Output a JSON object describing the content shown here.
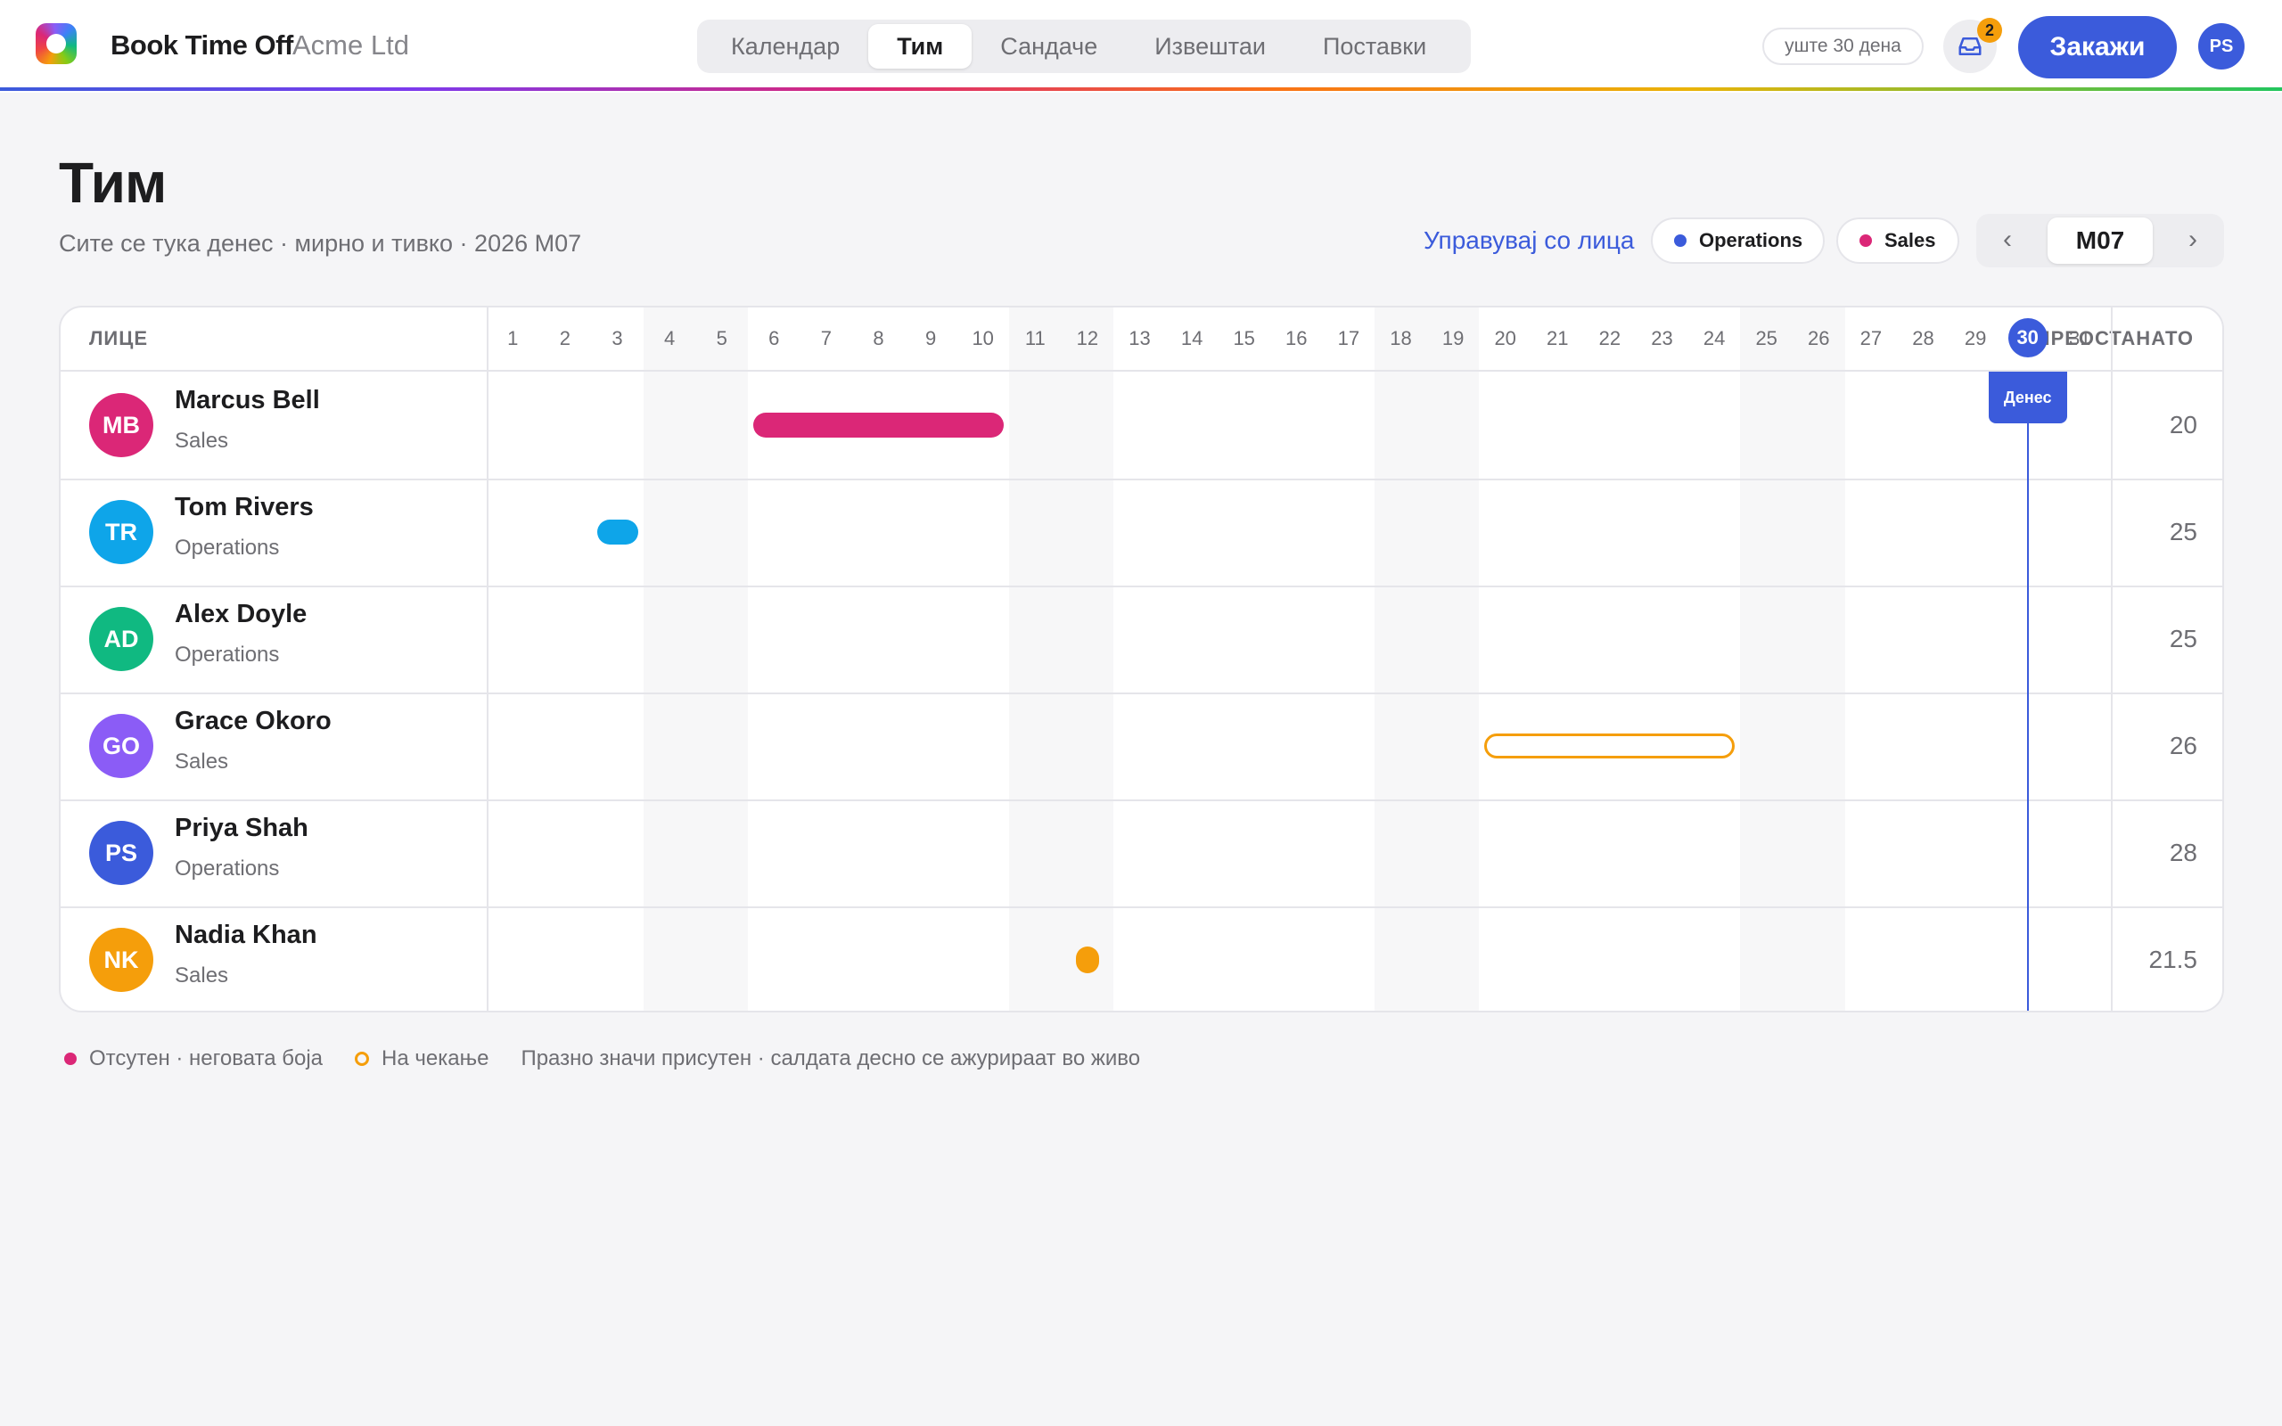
{
  "app": {
    "brand": "Book Time Off",
    "company": "Acme Ltd",
    "trial": "уште 30 дена",
    "inbox_count": "2",
    "book_label": "Закажи",
    "user_initials": "PS"
  },
  "nav": {
    "tabs": [
      {
        "label": "Календар",
        "active": false
      },
      {
        "label": "Тим",
        "active": true
      },
      {
        "label": "Сандаче",
        "active": false
      },
      {
        "label": "Извештаи",
        "active": false
      },
      {
        "label": "Поставки",
        "active": false
      }
    ]
  },
  "header": {
    "title": "Тим",
    "subtitle": "Сите се тука денес · мирно и тивко · 2026 M07",
    "manage_link": "Управувај со лица",
    "filters": [
      {
        "label": "Operations",
        "color": "#3b5bdb"
      },
      {
        "label": "Sales",
        "color": "#db2777"
      }
    ],
    "month": {
      "prev": "‹",
      "label": "M07",
      "next": "›"
    }
  },
  "grid": {
    "person_header": "ЛИЦЕ",
    "remaining_header": "ПРЕОСТАНАТО",
    "days": [
      "1",
      "2",
      "3",
      "4",
      "5",
      "6",
      "7",
      "8",
      "9",
      "10",
      "11",
      "12",
      "13",
      "14",
      "15",
      "16",
      "17",
      "18",
      "19",
      "20",
      "21",
      "22",
      "23",
      "24",
      "25",
      "26",
      "27",
      "28",
      "29",
      "30",
      "31"
    ],
    "weekend_days": [
      4,
      5,
      11,
      12,
      18,
      19,
      25,
      26
    ],
    "today": 30,
    "today_label": "Денес",
    "people": [
      {
        "initials": "MB",
        "name": "Marcus Bell",
        "dept": "Sales",
        "avatar_color": "#db2777",
        "remaining": "20",
        "absences": [
          {
            "start": 6,
            "end": 10,
            "color": "#db2777",
            "pending": false
          }
        ]
      },
      {
        "initials": "TR",
        "name": "Tom Rivers",
        "dept": "Operations",
        "avatar_color": "#0ea5e9",
        "remaining": "25",
        "absences": [
          {
            "start": 3,
            "end": 3,
            "color": "#0ea5e9",
            "pending": false
          }
        ]
      },
      {
        "initials": "AD",
        "name": "Alex Doyle",
        "dept": "Operations",
        "avatar_color": "#10b981",
        "remaining": "25",
        "absences": []
      },
      {
        "initials": "GO",
        "name": "Grace Okoro",
        "dept": "Sales",
        "avatar_color": "#8b5cf6",
        "remaining": "26",
        "absences": [
          {
            "start": 20,
            "end": 24,
            "color": "#f59e0b",
            "pending": true
          }
        ]
      },
      {
        "initials": "PS",
        "name": "Priya Shah",
        "dept": "Operations",
        "avatar_color": "#3b5bdb",
        "remaining": "28",
        "absences": []
      },
      {
        "initials": "NK",
        "name": "Nadia Khan",
        "dept": "Sales",
        "avatar_color": "#f59e0b",
        "remaining": "21.5",
        "absences": [
          {
            "start": 12,
            "end": 12,
            "color": "#f59e0b",
            "pending": false,
            "half": true
          }
        ]
      }
    ]
  },
  "legend": {
    "absent": "Отсутен · неговата боја",
    "absent_color": "#db2777",
    "pending": "На чекање",
    "note": "Празно значи присутен · салдата десно се ажурираат во живо"
  }
}
